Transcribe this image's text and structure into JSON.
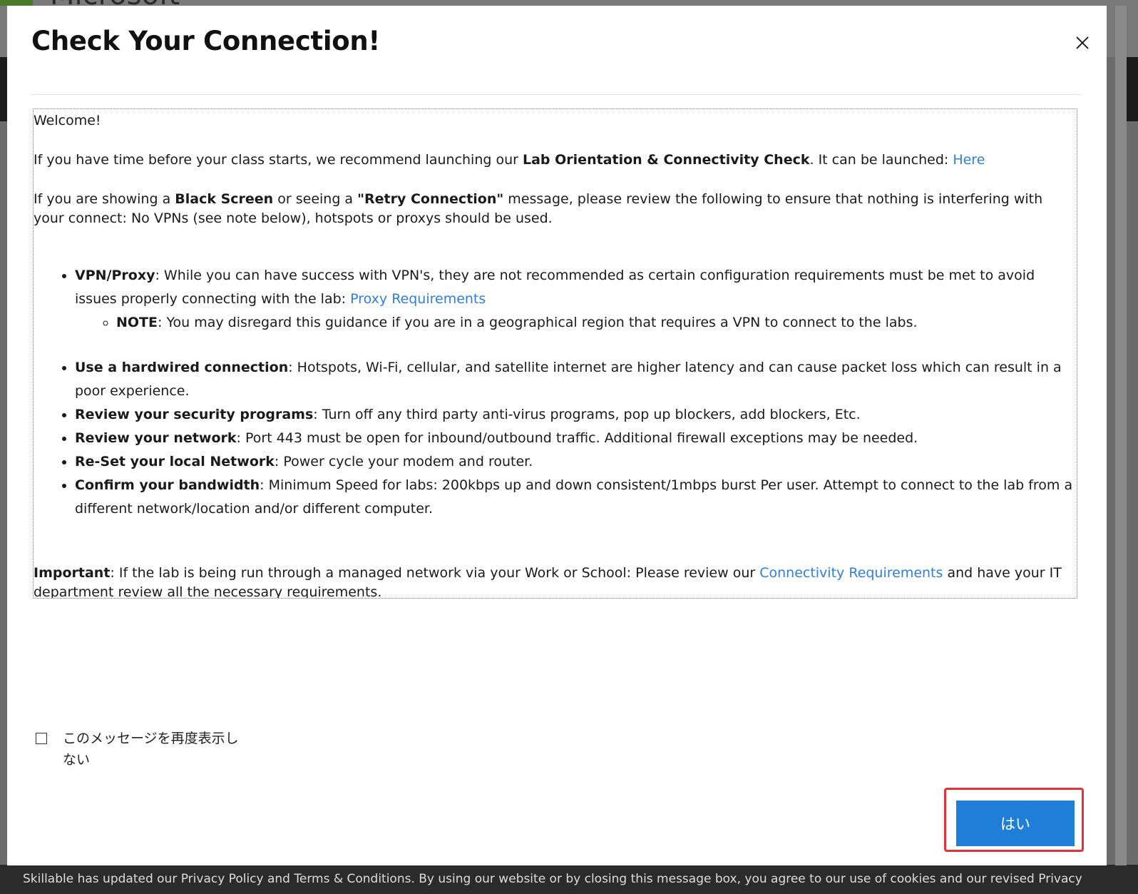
{
  "background": {
    "logo_text": "Microsoft",
    "footer_text": "Skillable has updated our Privacy Policy and Terms & Conditions. By using our website or by closing this message box, you agree to our use of cookies and our revised Privacy"
  },
  "modal": {
    "title": "Check Your Connection!",
    "close_icon": "close-icon",
    "welcome": "Welcome!",
    "lab_intro_pre": "If you have time before your class starts, we recommend launching our ",
    "lab_intro_bold": "Lab Orientation & Connectivity Check",
    "lab_intro_post": ". It can be launched: ",
    "lab_intro_link": "Here",
    "black_pre": "If you are showing a ",
    "black_bold1": "Black Screen",
    "black_mid": " or seeing a ",
    "black_bold2": "\"Retry Connection\"",
    "black_post": " message, please review the following to ensure that nothing is interfering with your connect: No VPNs (see note below), hotspots or proxys should be used.",
    "items": [
      {
        "bold": "VPN/Proxy",
        "text": ": While you can have success with VPN's, they are not recommended as certain configuration requirements must be met to avoid issues properly connecting with the lab: ",
        "link": "Proxy Requirements"
      },
      {
        "bold": "Use a hardwired connection",
        "text": ": Hotspots, Wi-Fi, cellular, and satellite internet are higher latency and can cause packet loss which can result in a poor experience."
      },
      {
        "bold": "Review your security programs",
        "text": ": Turn off any third party anti-virus programs, pop up blockers, add blockers, Etc."
      },
      {
        "bold": "Review your network",
        "text": ": Port 443 must be open for inbound/outbound traffic. Additional firewall exceptions may be needed."
      },
      {
        "bold": "Re-Set your local Network",
        "text": ": Power cycle your modem and router."
      },
      {
        "bold": "Confirm your bandwidth",
        "text": ": Minimum Speed for labs: 200kbps up and down consistent/1mbps burst Per user. Attempt to connect to the lab from a different network/location and/or different computer."
      }
    ],
    "note_bold": "NOTE",
    "note_text": ": You may disregard this guidance if you are in a geographical region that requires a VPN to connect to the labs.",
    "important_bold": "Important",
    "important_pre": ": If the lab is being run through a managed network via your Work or School: Please review our ",
    "important_link": "Connectivity Requirements",
    "important_post": " and have your IT department review all the necessary requirements.",
    "dont_show_label": "このメッセージを再度表示しない",
    "yes_label": "はい"
  },
  "colors": {
    "link": "#2f7fd8",
    "primary_button": "#1f7fd8",
    "highlight": "#e0333a"
  }
}
